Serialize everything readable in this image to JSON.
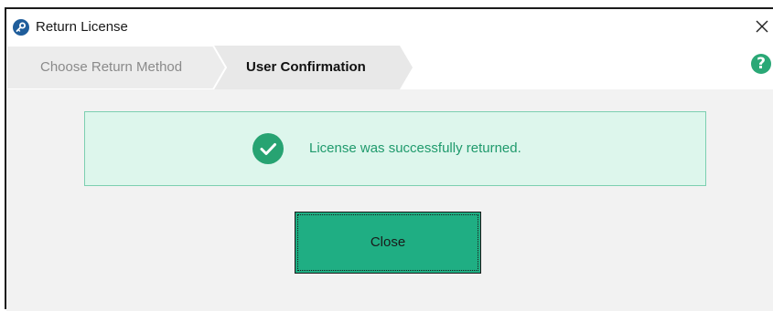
{
  "window": {
    "title": "Return License",
    "app_icon": "key-icon",
    "close_icon": "close-icon"
  },
  "steps": [
    {
      "label": "Choose Return Method",
      "state": "completed"
    },
    {
      "label": "User Confirmation",
      "state": "active"
    }
  ],
  "help": {
    "icon": "question-mark-icon",
    "glyph": "?"
  },
  "message": {
    "icon": "checkmark-icon",
    "text": "License was successfully returned."
  },
  "actions": {
    "close_label": "Close"
  },
  "colors": {
    "accent": "#1fae83",
    "success_text": "#1f9a6c",
    "success_bg": "#ddf6ec",
    "success_border": "#7ccfb0",
    "app_icon_bg": "#1f5d9b",
    "help_icon_bg": "#2aa876"
  }
}
